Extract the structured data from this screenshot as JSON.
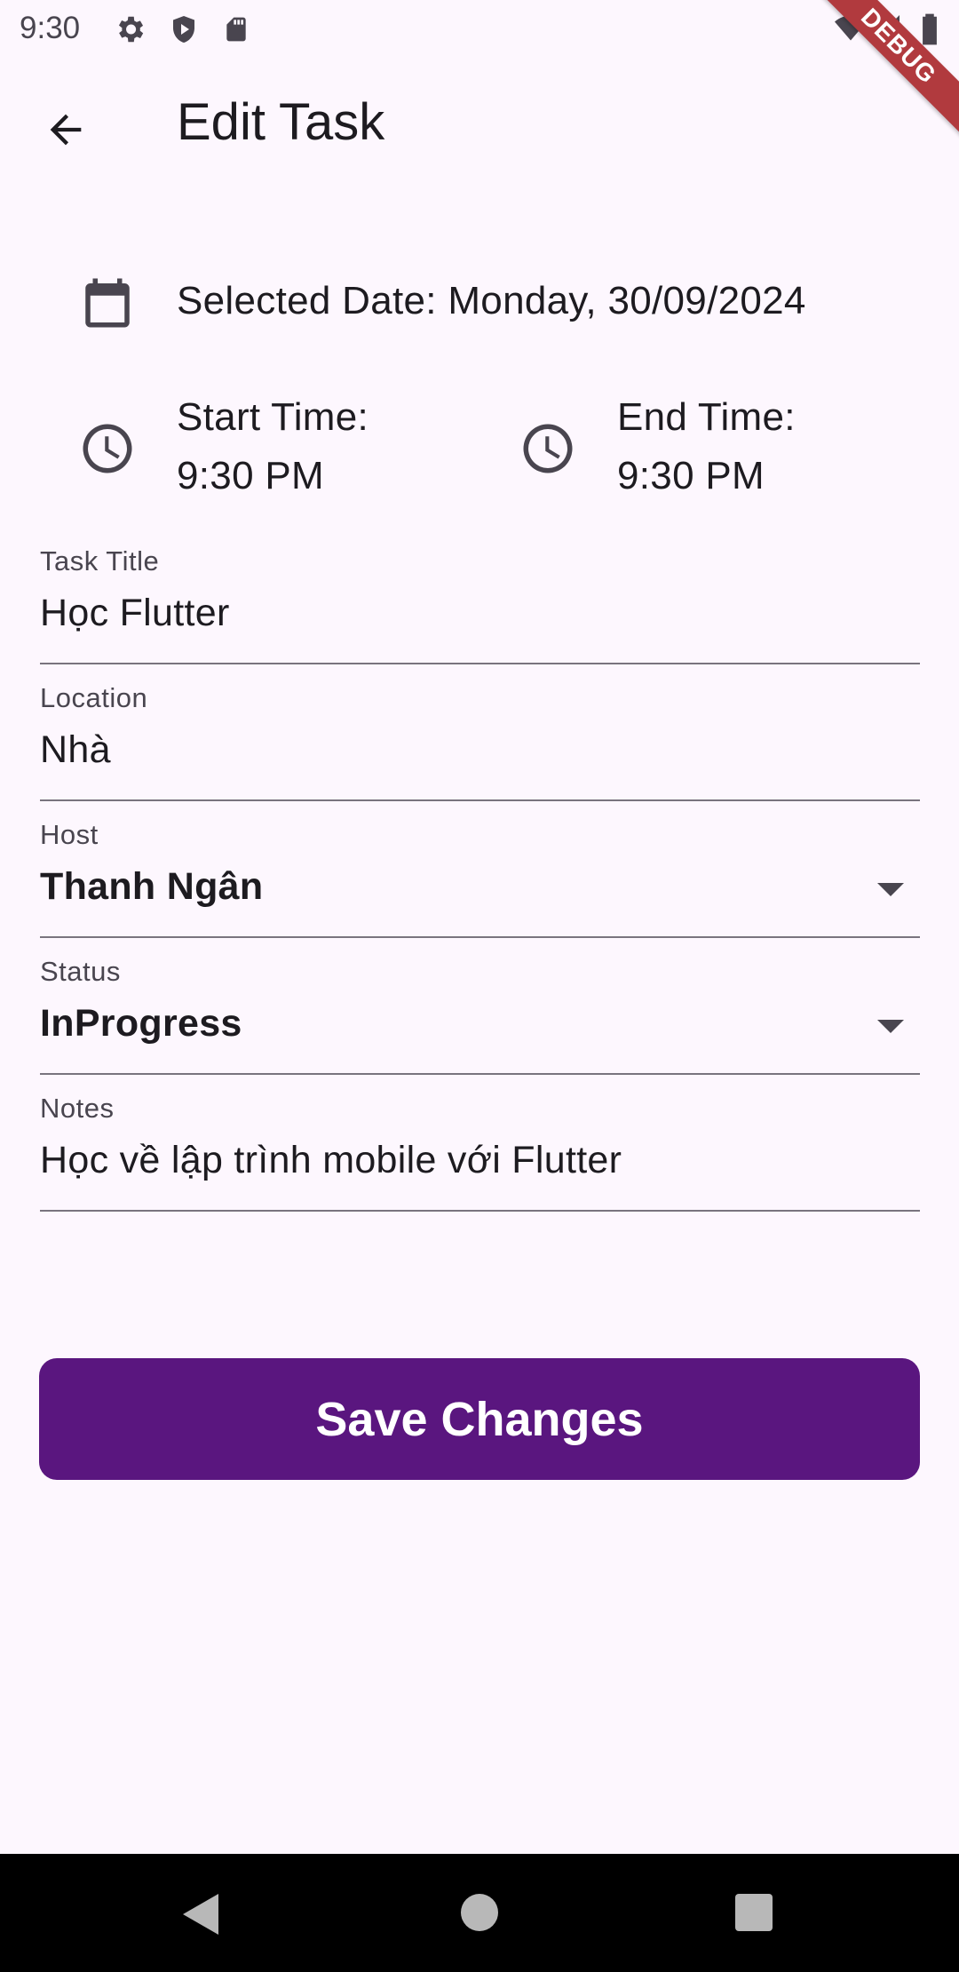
{
  "status_bar": {
    "time": "9:30",
    "left_icons": [
      "gear-icon",
      "shield-icon",
      "sd-card-icon"
    ],
    "right_icons": [
      "wifi-icon",
      "signal-icon",
      "battery-icon"
    ]
  },
  "debug_banner": "DEBUG",
  "app_bar": {
    "back_icon": "arrow-back-icon",
    "title": "Edit Task"
  },
  "date_row": {
    "icon": "calendar-icon",
    "text": "Selected Date: Monday, 30/09/2024"
  },
  "time_row": {
    "start": {
      "icon": "clock-icon",
      "label": "Start Time:",
      "value": "9:30 PM"
    },
    "end": {
      "icon": "clock-icon",
      "label": "End Time:",
      "value": "9:30 PM"
    }
  },
  "fields": {
    "task_title": {
      "label": "Task Title",
      "value": "Học Flutter"
    },
    "location": {
      "label": "Location",
      "value": "Nhà"
    },
    "host": {
      "label": "Host",
      "value": "Thanh Ngân"
    },
    "status": {
      "label": "Status",
      "value": "InProgress"
    },
    "notes": {
      "label": "Notes",
      "value": "Học về lập trình mobile với Flutter"
    }
  },
  "save_button": {
    "label": "Save Changes"
  },
  "colors": {
    "background": "#fdf7fe",
    "primary": "#5a167f",
    "debug": "#b13a3e"
  },
  "nav_bar": {
    "icons": [
      "back-triangle-icon",
      "home-circle-icon",
      "recents-square-icon"
    ]
  }
}
